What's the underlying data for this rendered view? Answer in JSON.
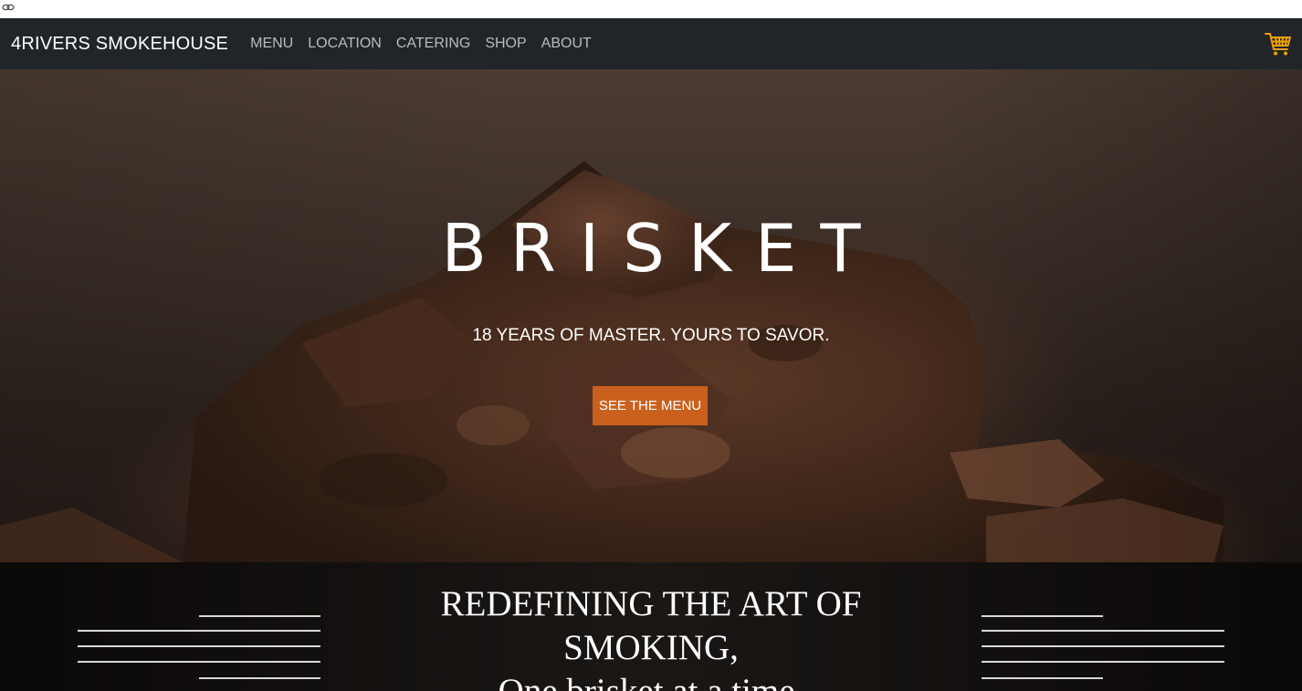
{
  "navbar": {
    "brand": "4RIVERS SMOKEHOUSE",
    "links": [
      "MENU",
      "LOCATION",
      "CATERING",
      "SHOP",
      "ABOUT"
    ],
    "cart_icon": "shopping-cart-icon",
    "cart_color": "#f0a000"
  },
  "hero": {
    "title": "BRISKET",
    "subtitle": "18 YEARS OF MASTER. YOURS TO SAVOR.",
    "button_label": "SEE THE MENU",
    "button_color": "#c9601e"
  },
  "tagline": {
    "line1": "REDEFINING THE ART OF",
    "line2": "SMOKING,",
    "line3": "One brisket at a time."
  },
  "colors": {
    "navbar_bg": "#212529",
    "nav_link": "#b9bcbf",
    "tagline_bg": "#14110f"
  }
}
